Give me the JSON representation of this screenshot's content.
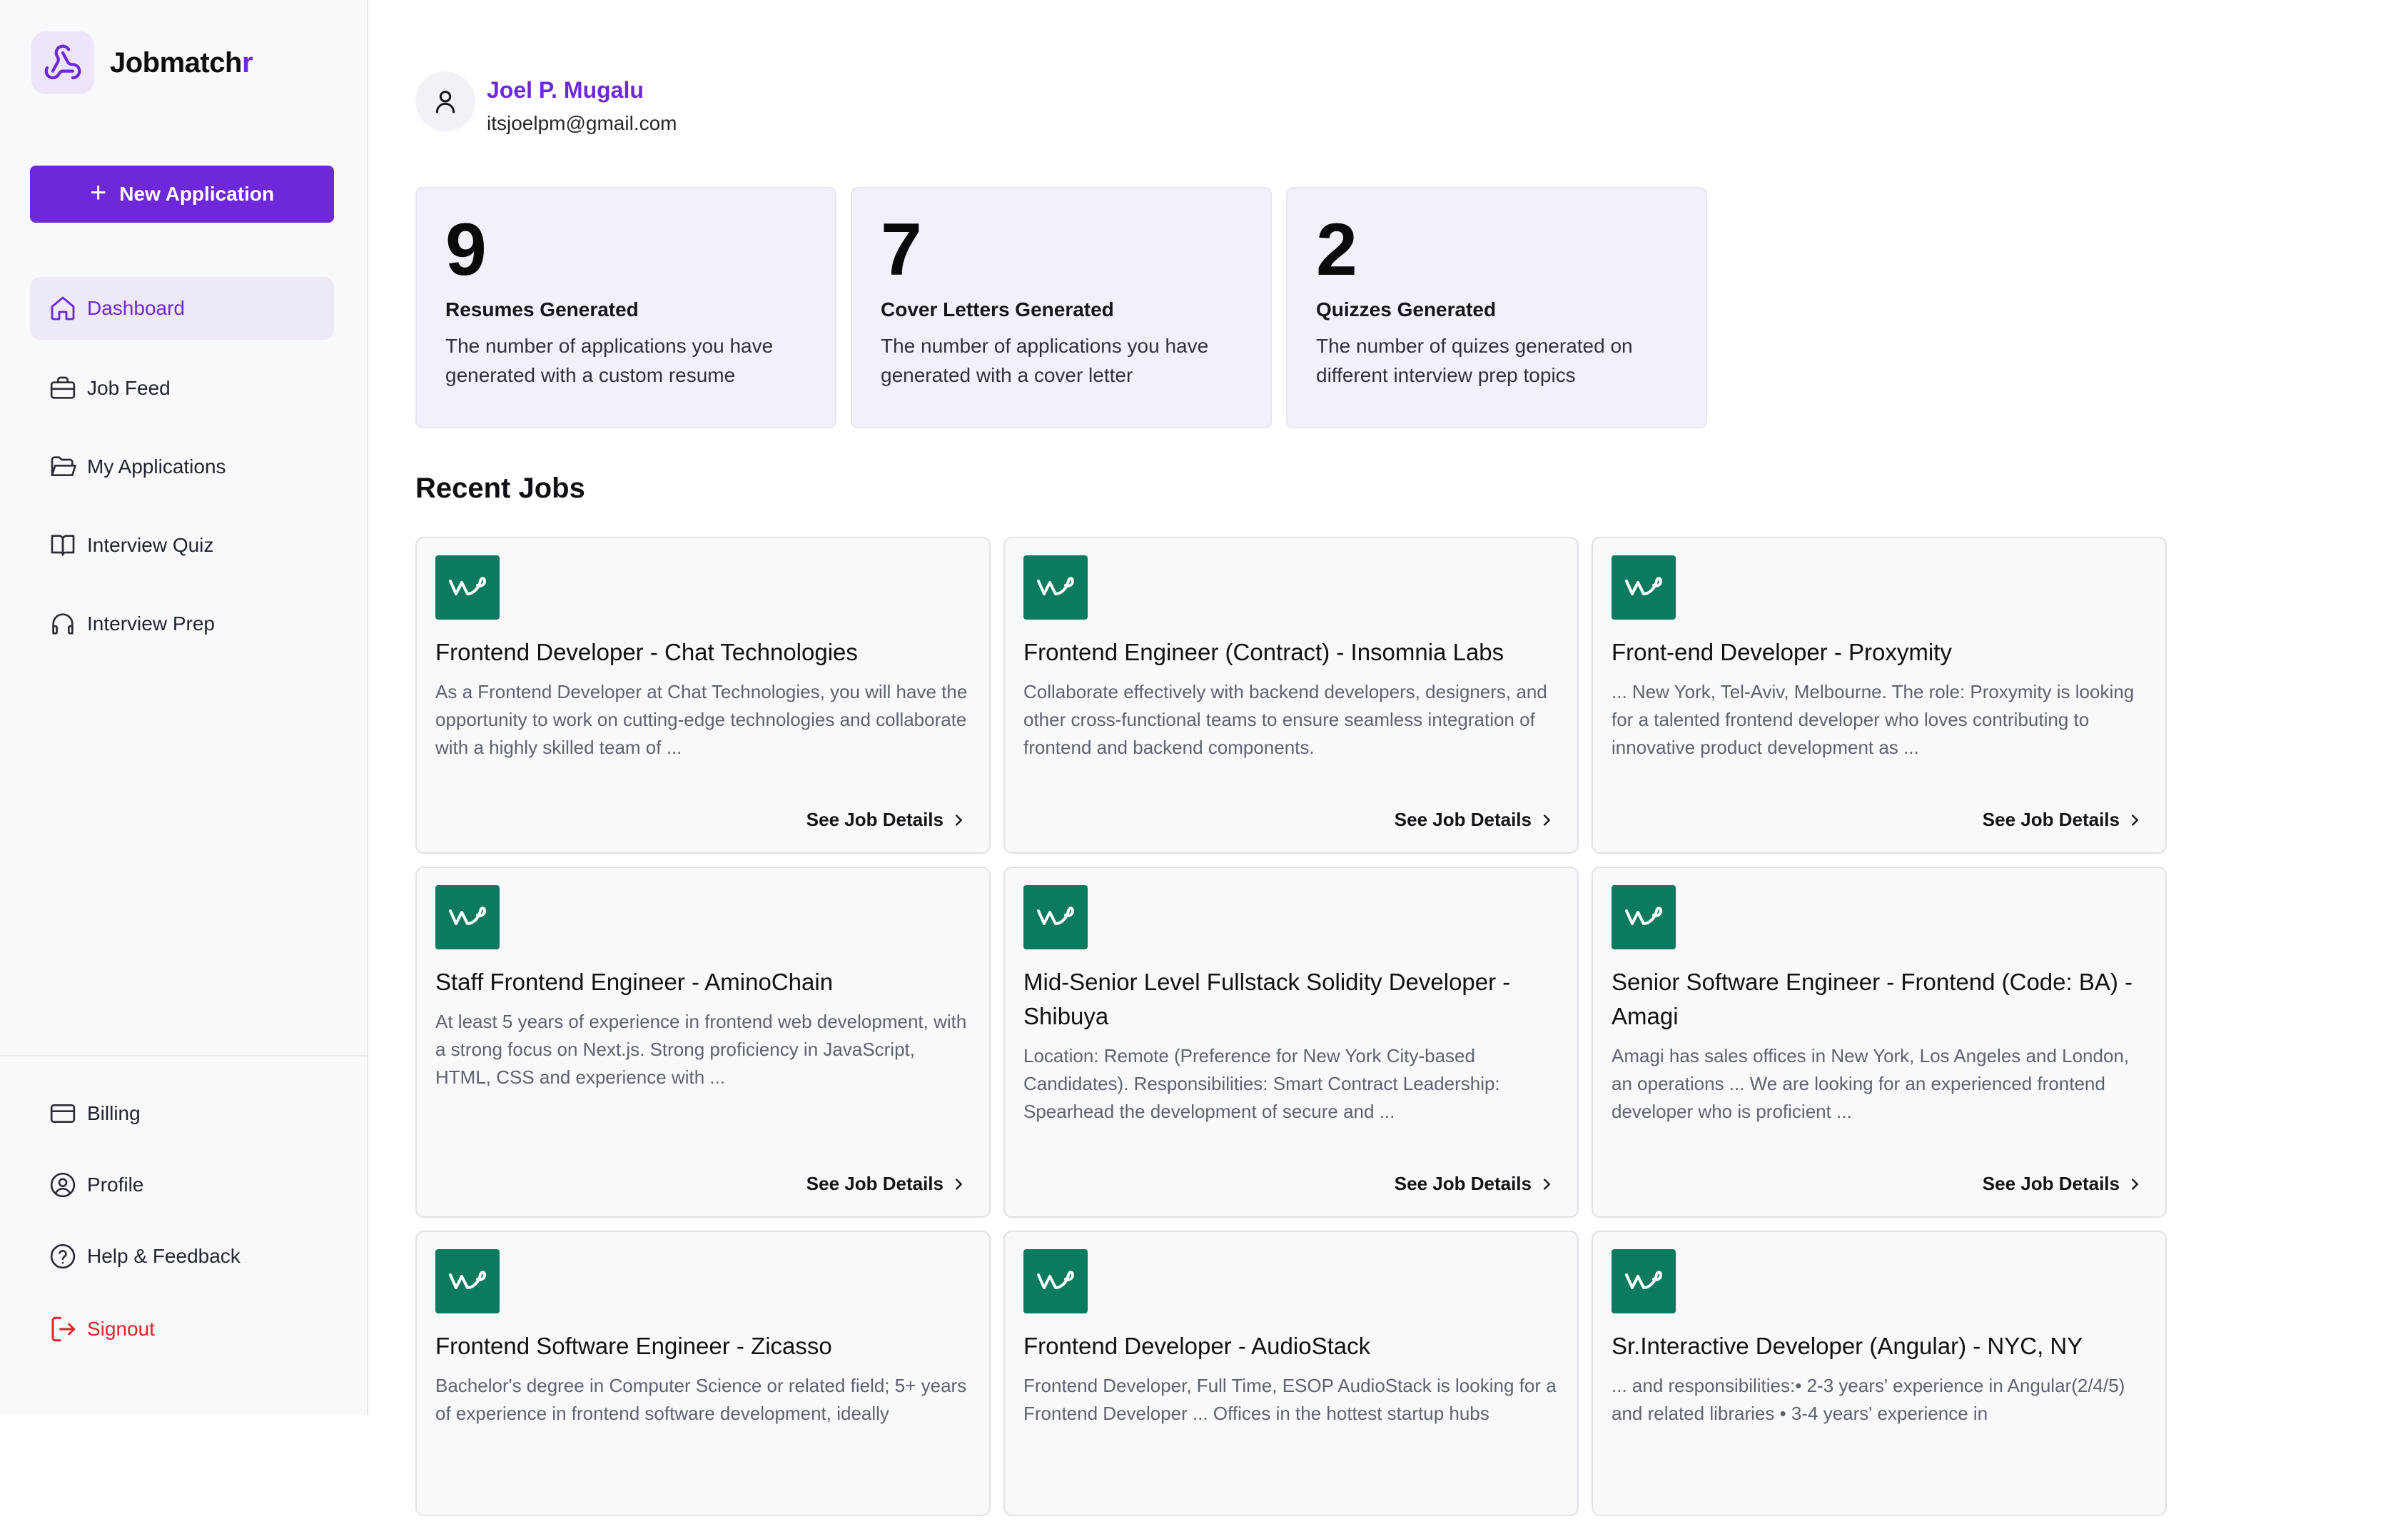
{
  "app": {
    "name_main": "Jobmatch",
    "name_accent": "r"
  },
  "sidebar": {
    "new_application_label": "New Application",
    "nav": [
      {
        "label": "Dashboard",
        "icon": "home-icon",
        "active": true
      },
      {
        "label": "Job Feed",
        "icon": "briefcase-icon"
      },
      {
        "label": "My Applications",
        "icon": "folder-icon"
      },
      {
        "label": "Interview Quiz",
        "icon": "book-icon"
      },
      {
        "label": "Interview Prep",
        "icon": "headphones-icon"
      }
    ],
    "bottom": [
      {
        "label": "Billing",
        "icon": "credit-card-icon"
      },
      {
        "label": "Profile",
        "icon": "user-circle-icon"
      },
      {
        "label": "Help & Feedback",
        "icon": "help-circle-icon"
      },
      {
        "label": "Signout",
        "icon": "logout-icon"
      }
    ]
  },
  "user": {
    "name": "Joel P. Mugalu",
    "email": "itsjoelpm@gmail.com"
  },
  "stats": [
    {
      "value": "9",
      "title": "Resumes Generated",
      "description": "The number of applications you have generated with a custom resume"
    },
    {
      "value": "7",
      "title": "Cover Letters Generated",
      "description": "The number of applications you have generated with a cover letter"
    },
    {
      "value": "2",
      "title": "Quizzes Generated",
      "description": "The number of quizes generated on different interview prep topics"
    }
  ],
  "recent_jobs": {
    "title": "Recent Jobs",
    "link_label": "See Job Details",
    "items": [
      {
        "title": "Frontend Developer - Chat Technologies",
        "description": "As a Frontend Developer at Chat Technologies, you will have the opportunity to work on cutting-edge technologies and collaborate with a highly skilled team of ..."
      },
      {
        "title": "Frontend Engineer (Contract) - Insomnia Labs",
        "description": "Collaborate effectively with backend developers, designers, and other cross-functional teams to ensure seamless integration of frontend and backend components."
      },
      {
        "title": "Front-end Developer - Proxymity",
        "description": "... New York, Tel-Aviv, Melbourne. The role: Proxymity is looking for a talented frontend developer who loves contributing to innovative product development as ..."
      },
      {
        "title": "Staff Frontend Engineer - AminoChain",
        "description": "At least 5 years of experience in frontend web development, with a strong focus on Next.js. Strong proficiency in JavaScript, HTML, CSS and experience with ..."
      },
      {
        "title": "Mid-Senior Level Fullstack Solidity Developer - Shibuya",
        "description": "Location: Remote (Preference for New York City-based Candidates). Responsibilities: Smart Contract Leadership: Spearhead the development of secure and ..."
      },
      {
        "title": "Senior Software Engineer - Frontend (Code: BA) - Amagi",
        "description": "Amagi has sales offices in New York, Los Angeles and London, an operations ... We are looking for an experienced frontend developer who is proficient ..."
      },
      {
        "title": "Frontend Software Engineer - Zicasso",
        "description": "Bachelor's degree in Computer Science or related field; 5+ years of experience in frontend software development, ideally"
      },
      {
        "title": "Frontend Developer - AudioStack",
        "description": "Frontend Developer, Full Time, ESOP AudioStack is looking for a Frontend Developer ... Offices in the hottest startup hubs"
      },
      {
        "title": "Sr.Interactive Developer (Angular) - NYC, NY",
        "description": "... and responsibilities:• 2-3 years' experience in Angular(2/4/5) and related libraries • 3-4 years' experience in"
      }
    ]
  },
  "colors": {
    "accent": "#6d28d9",
    "job_logo_bg": "#0b7a5f",
    "danger": "#dc2626"
  }
}
